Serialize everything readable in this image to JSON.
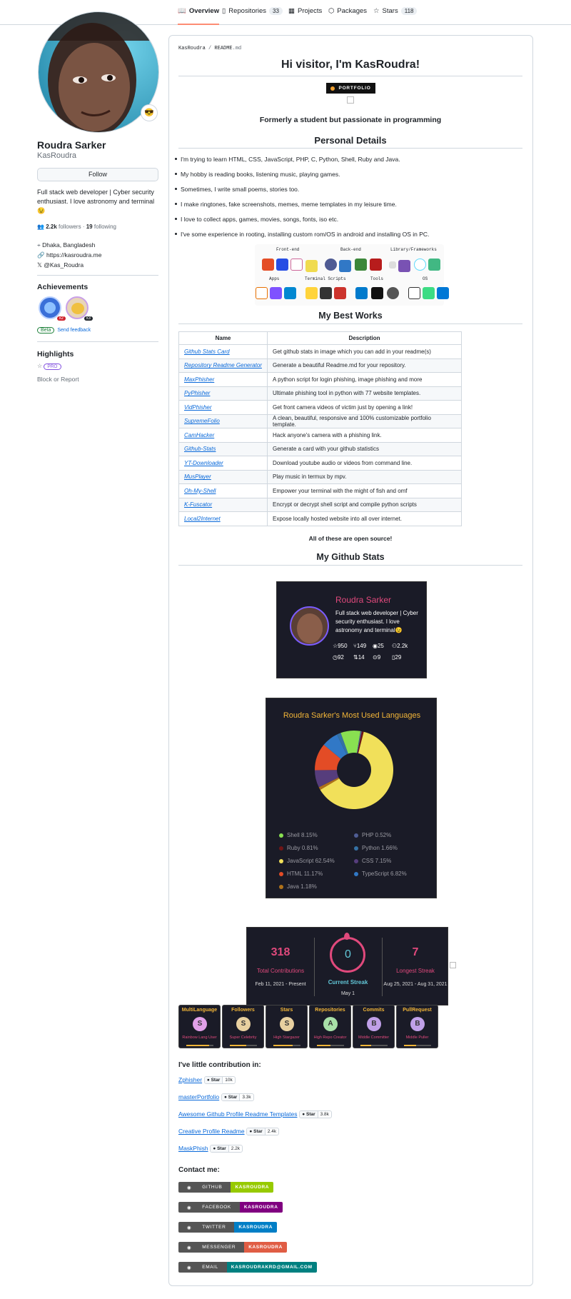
{
  "nav": {
    "tabs": [
      {
        "label": "Overview",
        "count": ""
      },
      {
        "label": "Repositories",
        "count": "33"
      },
      {
        "label": "Projects",
        "count": ""
      },
      {
        "label": "Packages",
        "count": ""
      },
      {
        "label": "Stars",
        "count": "118"
      }
    ]
  },
  "profile": {
    "name": "Roudra Sarker",
    "username": "KasRoudra",
    "follow_label": "Follow",
    "bio": "Full stack web developer | Cyber security enthusiast. I love astronomy and terminal 😉",
    "followers": "2.2k",
    "followers_label": "followers",
    "following": "19",
    "following_label": "following",
    "location": "Dhaka, Bangladesh",
    "website": "https://kasroudra.me",
    "twitter": "@Kas_Roudra",
    "achievements_title": "Achievements",
    "achievement_counts": [
      "x2",
      "x3"
    ],
    "beta_label": "Beta",
    "feedback_label": "Send feedback",
    "highlights_title": "Highlights",
    "pro_label": "PRO",
    "block_label": "Block or Report"
  },
  "readme": {
    "breadcrumb_user": "KasRoudra",
    "breadcrumb_sep": " / ",
    "breadcrumb_file": "README",
    "breadcrumb_ext": ".md",
    "greeting": "Hi visitor, I'm KasRoudra!",
    "portfolio_badge": "PORTFOLIO",
    "tagline": "Formerly a student but passionate in programming",
    "personal_title": "Personal Details",
    "details": [
      "I'm trying to learn HTML, CSS, JavaScript, PHP, C, Python, Shell, Ruby and Java.",
      "My hobby is reading books, listening music, playing games.",
      "Sometimes, I write small poems, stories too.",
      "I make ringtones, fake screenshots, memes, meme templates in my leisure time.",
      "I love to collect apps, games, movies, songs, fonts, iso etc.",
      "I've some experience in rooting, installing custom rom/OS in android and installing OS in PC."
    ],
    "skill_groups": [
      "Front-end",
      "Back-end",
      "Library/Frameworks",
      "Apps",
      "Terminal Scripts",
      "Tools",
      "OS"
    ],
    "works_title": "My Best Works",
    "works_headers": [
      "Name",
      "Description"
    ],
    "works": [
      {
        "name": "Github Stats Card",
        "desc": "Get github stats in image which you can add in your readme(s)"
      },
      {
        "name": "Repository Readme Generator",
        "desc": "Generate a beautiful Readme.md for your repository."
      },
      {
        "name": "MaxPhisher",
        "desc": "A python script for login phishing, image phishing and more"
      },
      {
        "name": "PyPhisher",
        "desc": "Ultimate phishing tool in python with 77 website templates."
      },
      {
        "name": "VidPhisher",
        "desc": "Get front camera videos of victim just by opening a link!"
      },
      {
        "name": "SupremeFolio",
        "desc": "A clean, beautiful, responsive and 100% customizable portfolio template."
      },
      {
        "name": "CamHacker",
        "desc": "Hack anyone's camera with a phishing link."
      },
      {
        "name": "Github-Stats",
        "desc": "Generate a card with your github statistics"
      },
      {
        "name": "YT-Downloader",
        "desc": "Download youtube audio or videos from command line."
      },
      {
        "name": "MusPlayer",
        "desc": "Play music in termux by mpv."
      },
      {
        "name": "Oh-My-Shell",
        "desc": "Empower your terminal with the might of fish and omf"
      },
      {
        "name": "K-Fuscator",
        "desc": "Encrypt or decrypt shell script and compile python scripts"
      },
      {
        "name": "Local2Internet",
        "desc": "Expose locally hosted website into all over internet."
      }
    ],
    "open_source_note": "All of these are open source!",
    "stats_title": "My Github Stats",
    "stats_card": {
      "name": "Roudra Sarker",
      "bio": "Full stack web developer | Cyber security enthusiast. I love astronomy and terminal😉",
      "stars": "950",
      "forks": "149",
      "watchers": "25",
      "followers": "2.2k",
      "commits": "92",
      "prs": "14",
      "issues": "9",
      "repos": "29"
    },
    "langs_card": {
      "title": "Roudra Sarker's Most Used Languages",
      "items": [
        {
          "label": "Shell 8.15%",
          "color": "#89e051"
        },
        {
          "label": "PHP 0.52%",
          "color": "#4F5D95"
        },
        {
          "label": "Ruby 0.81%",
          "color": "#701516"
        },
        {
          "label": "Python 1.66%",
          "color": "#3572A5"
        },
        {
          "label": "JavaScript 62.54%",
          "color": "#f1e05a"
        },
        {
          "label": "CSS 7.15%",
          "color": "#563d7c"
        },
        {
          "label": "HTML 11.17%",
          "color": "#e34c26"
        },
        {
          "label": "TypeScript 6.82%",
          "color": "#3178c6"
        },
        {
          "label": "Java 1.18%",
          "color": "#b07219"
        }
      ]
    },
    "streak_card": {
      "total": "318",
      "total_label": "Total Contributions",
      "total_range": "Feb 11, 2021 - Present",
      "current": "0",
      "current_label": "Current Streak",
      "current_range": "May 1",
      "longest": "7",
      "longest_label": "Longest Streak",
      "longest_range": "Aug 25, 2021 - Aug 31, 2021"
    },
    "trophies": [
      {
        "title": "MultiLanguage",
        "rank": "S",
        "sub": "Rainbow Lang User",
        "color": "#e0a0e8",
        "level": 0.85
      },
      {
        "title": "Followers",
        "rank": "S",
        "sub": "Super Celebrity",
        "color": "#e8d0a0",
        "level": 0.6
      },
      {
        "title": "Stars",
        "rank": "S",
        "sub": "High Stargazer",
        "color": "#e8d0a0",
        "level": 0.7
      },
      {
        "title": "Repositories",
        "rank": "A",
        "sub": "High Repo Creator",
        "color": "#a8e0a8",
        "level": 0.5
      },
      {
        "title": "Commits",
        "rank": "B",
        "sub": "Middle Committer",
        "color": "#c0a0e8",
        "level": 0.4
      },
      {
        "title": "PullRequest",
        "rank": "B",
        "sub": "Middle Puller",
        "color": "#c0a0e8",
        "level": 0.45
      }
    ],
    "contrib_title": "I've little contribution in:",
    "contribs": [
      {
        "name": "Zphisher",
        "stars": "10k"
      },
      {
        "name": "masterPortfolio",
        "stars": "3.3k"
      },
      {
        "name": "Awesome Github Profile Readme Templates",
        "stars": "3.8k"
      },
      {
        "name": "Creative Profile Readme",
        "stars": "2.4k"
      },
      {
        "name": "MaskPhish",
        "stars": "2.2k"
      }
    ],
    "star_label": "Star",
    "contact_title": "Contact me:",
    "contacts": [
      {
        "label": "GITHUB",
        "value": "KASROUDRA",
        "color": "#97ca00"
      },
      {
        "label": "FACEBOOK",
        "value": "KASROUDRA",
        "color": "#800080"
      },
      {
        "label": "TWITTER",
        "value": "KASROUDRA",
        "color": "#007ec6"
      },
      {
        "label": "MESSENGER",
        "value": "KASROUDRA",
        "color": "#e05d44"
      },
      {
        "label": "EMAIL",
        "value": "KASROUDRAKRD@GMAIL.COM",
        "color": "#008080"
      }
    ]
  }
}
